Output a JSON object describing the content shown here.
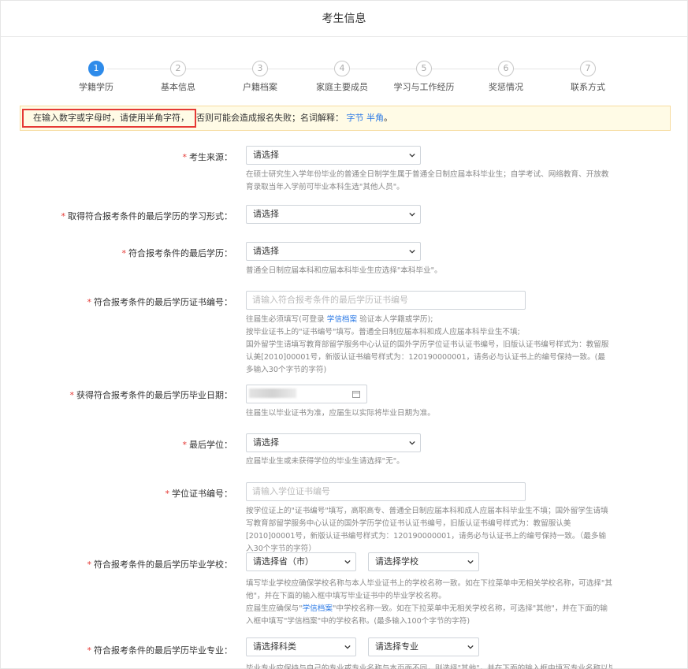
{
  "page": {
    "title": "考生信息"
  },
  "steps": [
    {
      "num": "1",
      "label": "学籍学历",
      "active": true
    },
    {
      "num": "2",
      "label": "基本信息",
      "active": false
    },
    {
      "num": "3",
      "label": "户籍档案",
      "active": false
    },
    {
      "num": "4",
      "label": "家庭主要成员",
      "active": false
    },
    {
      "num": "5",
      "label": "学习与工作经历",
      "active": false
    },
    {
      "num": "6",
      "label": "奖惩情况",
      "active": false
    },
    {
      "num": "7",
      "label": "联系方式",
      "active": false
    }
  ],
  "notice": {
    "highlight": "在输入数字或字母时，请使用半角字符，",
    "rest": "否则可能会造成报名失败；名词解释：",
    "link1": "字节",
    "link2": "半角",
    "end": "。"
  },
  "form": {
    "source": {
      "label": "考生来源：",
      "value": "请选择",
      "hint": "在硕士研究生入学年份毕业的普通全日制学生属于普通全日制应届本科毕业生；自学考试、网络教育、开放教育录取当年入学前可毕业本科生选\"其他人员\"。"
    },
    "study_form": {
      "label": "取得符合报考条件的最后学历的学习形式：",
      "value": "请选择"
    },
    "last_edu": {
      "label": "符合报考条件的最后学历：",
      "value": "请选择",
      "hint": "普通全日制应届本科和应届本科毕业生应选择\"本科毕业\"。"
    },
    "cert_no": {
      "label": "符合报考条件的最后学历证书编号：",
      "placeholder": "请输入符合报考条件的最后学历证书编号",
      "hint1_a": "往届生必须填写(可登录 ",
      "hint1_link": "学信档案",
      "hint1_b": " 验证本人学籍或学历);",
      "hint2": "按毕业证书上的\"证书编号\"填写。普通全日制应届本科和成人应届本科毕业生不填;",
      "hint3": "国外留学生请填写教育部留学服务中心认证的国外学历学位证书认证书编号，旧版认证书编号样式为：教留服认美[2010]00001号，新版认证书编号样式为：120190000001，请务必与认证书上的编号保持一致。(最多输入30个字节的字符)"
    },
    "grad_date": {
      "label": "获得符合报考条件的最后学历毕业日期：",
      "hint": "往届生以毕业证书为准，应届生以实际将毕业日期为准。"
    },
    "degree": {
      "label": "最后学位：",
      "value": "请选择",
      "hint": "应届毕业生或未获得学位的毕业生请选择\"无\"。"
    },
    "degree_cert": {
      "label": "学位证书编号：",
      "placeholder": "请输入学位证书编号",
      "hint": "按学位证上的\"证书编号\"填写，高职高专、普通全日制应届本科和成人应届本科毕业生不填；国外留学生请填写教育部留学服务中心认证的国外学历学位证书认证书编号，旧版认证书编号样式为：教留服认美[2010]00001号，新版认证书编号样式为：120190000001，请务必与认证书上的编号保持一致。（最多输入30个字节的字符）"
    },
    "school": {
      "label": "符合报考条件的最后学历毕业学校：",
      "province": "请选择省（市）",
      "school": "请选择学校",
      "hint1": "填写毕业学校应确保学校名称与本人毕业证书上的学校名称一致。如在下拉菜单中无相关学校名称，可选择\"其他\"，并在下面的输入框中填写毕业证书中的毕业学校名称。",
      "hint2_a": "应届生应确保与\"",
      "hint2_link": "学信档案",
      "hint2_b": "\"中学校名称一致。如在下拉菜单中无相关学校名称，可选择\"其他\"，并在下面的输入框中填写\"学信档案\"中的学校名称。(最多输入100个字节的字符)"
    },
    "major": {
      "label": "符合报考条件的最后学历毕业专业：",
      "category": "请选择科类",
      "major": "请选择专业",
      "hint": "毕业专业应保持与自己的专业或专业名称与本页面不同，则选择\"其他\"，并在下面的输入框中填写专业名称以毕业证书"
    }
  }
}
